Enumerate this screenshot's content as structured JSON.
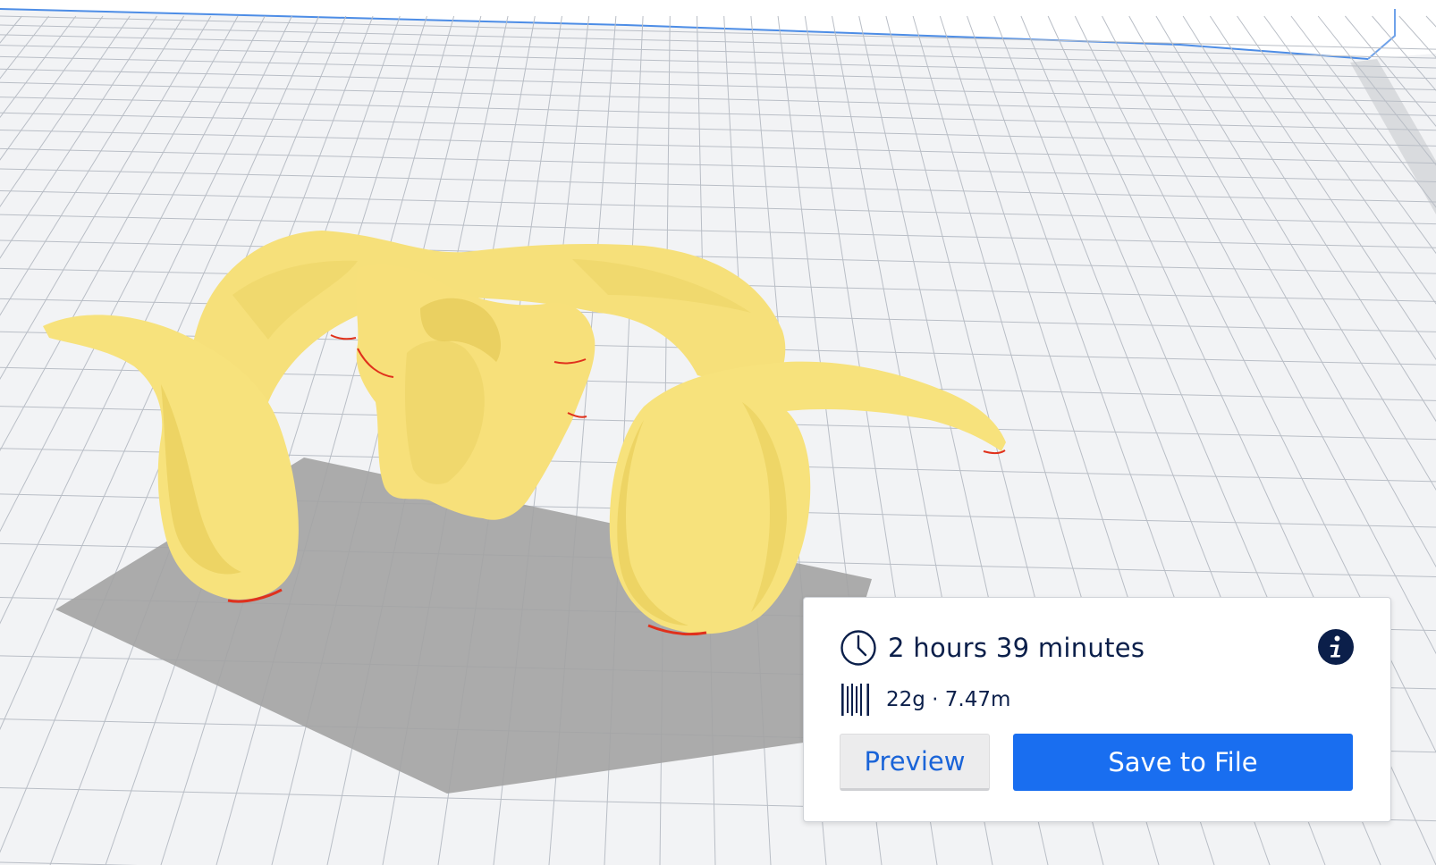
{
  "viewport": {
    "model_color": "#f9e680",
    "model_shade": "#e3c94f",
    "shadow_color": "#9c9c9c",
    "grid_line_color": "#b9bec6",
    "plate_color": "#f2f3f5"
  },
  "print_info": {
    "time_icon": "clock-icon",
    "print_time": "2 hours 39 minutes",
    "info_icon": "info-icon",
    "material_icon": "spool-icon",
    "material_usage": "22g · 7.47m",
    "preview_label": "Preview",
    "save_label": "Save to File",
    "accent_color": "#196ef0"
  }
}
